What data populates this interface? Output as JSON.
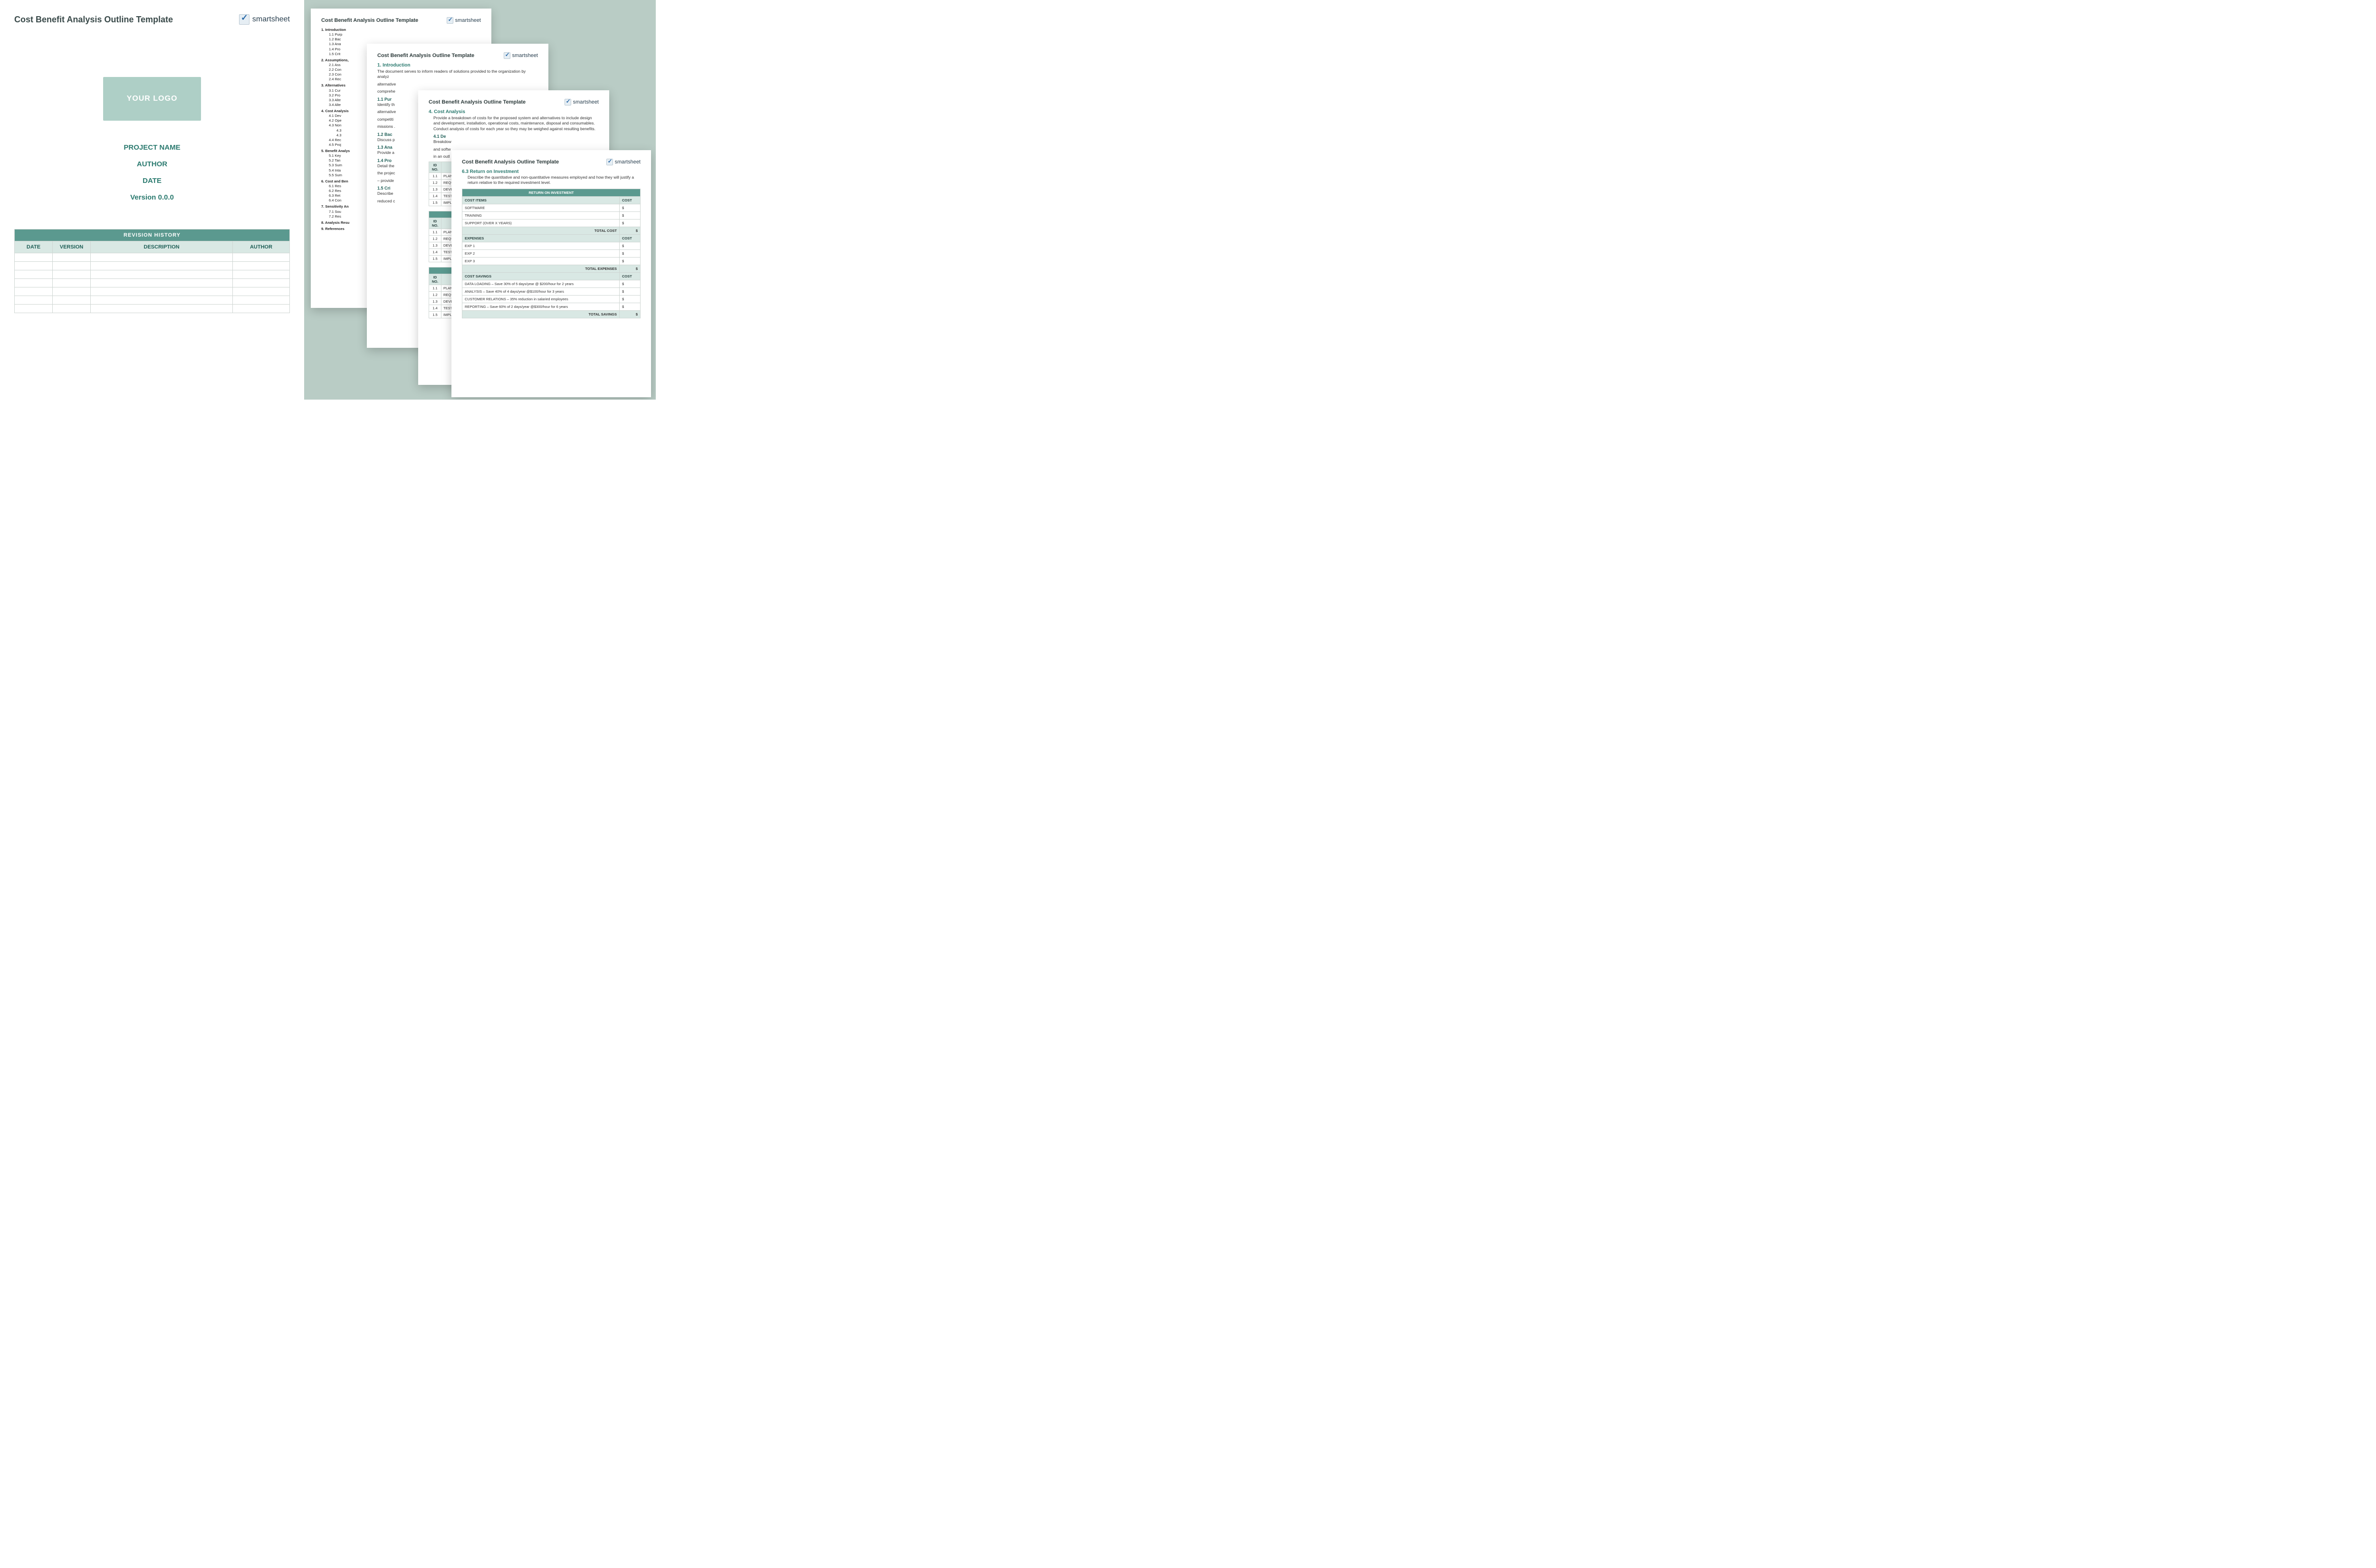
{
  "brand": {
    "name": "smartsheet"
  },
  "title": "Cost Benefit Analysis Outline Template",
  "cover": {
    "logo_label": "YOUR LOGO",
    "project_name": "PROJECT NAME",
    "author": "AUTHOR",
    "date": "DATE",
    "version": "Version 0.0.0"
  },
  "revision_table": {
    "bar": "REVISION HISTORY",
    "cols": [
      "DATE",
      "VERSION",
      "DESCRIPTION",
      "AUTHOR"
    ],
    "blank_rows": 7
  },
  "page2_toc": {
    "items": [
      {
        "l": 1,
        "n": "1.",
        "t": "Introduction"
      },
      {
        "l": 2,
        "n": "1.1",
        "t": "Purp"
      },
      {
        "l": 2,
        "n": "1.2",
        "t": "Bac"
      },
      {
        "l": 2,
        "n": "1.3",
        "t": "Ana"
      },
      {
        "l": 2,
        "n": "1.4",
        "t": "Pro"
      },
      {
        "l": 2,
        "n": "1.5",
        "t": "Crit"
      },
      {
        "l": 1,
        "n": "2.",
        "t": "Assumptions,"
      },
      {
        "l": 2,
        "n": "2.1",
        "t": "Ass"
      },
      {
        "l": 2,
        "n": "2.2",
        "t": "Con"
      },
      {
        "l": 2,
        "n": "2.3",
        "t": "Con"
      },
      {
        "l": 2,
        "n": "2.4",
        "t": "Rec"
      },
      {
        "l": 1,
        "n": "3.",
        "t": "Alternatives"
      },
      {
        "l": 2,
        "n": "3.1",
        "t": "Cur"
      },
      {
        "l": 2,
        "n": "3.2",
        "t": "Pro"
      },
      {
        "l": 2,
        "n": "3.3",
        "t": "Alte"
      },
      {
        "l": 2,
        "n": "3.4",
        "t": "Alte"
      },
      {
        "l": 1,
        "n": "4.",
        "t": "Cost Analysis"
      },
      {
        "l": 2,
        "n": "4.1",
        "t": "Dev"
      },
      {
        "l": 2,
        "n": "4.2",
        "t": "Ope"
      },
      {
        "l": 2,
        "n": "4.3",
        "t": "Non"
      },
      {
        "l": 3,
        "n": "4.3",
        "t": ""
      },
      {
        "l": 3,
        "n": "4.3",
        "t": ""
      },
      {
        "l": 2,
        "n": "4.4",
        "t": "Rec"
      },
      {
        "l": 2,
        "n": "4.5",
        "t": "Proj"
      },
      {
        "l": 1,
        "n": "5.",
        "t": "Benefit Analys"
      },
      {
        "l": 2,
        "n": "5.1",
        "t": "Key"
      },
      {
        "l": 2,
        "n": "5.2",
        "t": "Tan"
      },
      {
        "l": 2,
        "n": "5.3",
        "t": "Sum"
      },
      {
        "l": 2,
        "n": "5.4",
        "t": "Inta"
      },
      {
        "l": 2,
        "n": "5.5",
        "t": "Sum"
      },
      {
        "l": 1,
        "n": "6.",
        "t": "Cost and Ben"
      },
      {
        "l": 2,
        "n": "6.1",
        "t": "Res"
      },
      {
        "l": 2,
        "n": "6.2",
        "t": "Res"
      },
      {
        "l": 2,
        "n": "6.3",
        "t": "Ret"
      },
      {
        "l": 2,
        "n": "6.4",
        "t": "Con"
      },
      {
        "l": 1,
        "n": "7.",
        "t": "Sensitivity An"
      },
      {
        "l": 2,
        "n": "7.1",
        "t": "Sou"
      },
      {
        "l": 2,
        "n": "7.2",
        "t": "Res"
      },
      {
        "l": 1,
        "n": "8.",
        "t": "Analysis Resu"
      },
      {
        "l": 1,
        "n": "9.",
        "t": "References"
      }
    ]
  },
  "page3": {
    "sec1": "1. Introduction",
    "intro": "The document serves to inform readers of solutions provided to the organization by analyz",
    "intro2": "alternative",
    "intro3": "comprehe",
    "h11": "1.1  Pur",
    "t11a": "Identify th",
    "t11b": "alternative",
    "t11c": "competiti",
    "t11d": "missions .",
    "h12": "1.2  Bac",
    "t12": "Discuss p",
    "h13": "1.3  Ana",
    "t13": "Provide a",
    "h14": "1.4  Pro",
    "t14a": "Detail the",
    "t14b": "the projec",
    "t14c": "– provide",
    "h15": "1.5  Cri",
    "t15a": "Describe",
    "t15b": "reduced c"
  },
  "page4": {
    "sec4": "4. Cost Analysis",
    "sec4_body": "Provide a breakdown of costs for the proposed system and alternatives to include design and development, installation, operational costs, maintenance, disposal and consumables. Conduct analysis of costs for each year so they may be weighed against resulting benefits.",
    "h41": "4.1  De",
    "t41a": "Breakdow",
    "t41b": "and softw",
    "t41c": "in an outl",
    "mini_header": {
      "c1": "ID NO.",
      "c2": ""
    },
    "mini_rows": [
      {
        "n": "1.1",
        "t": "PLANN"
      },
      {
        "n": "1.2",
        "t": "REQUI"
      },
      {
        "n": "1.3",
        "t": "DEVEL"
      },
      {
        "n": "1.4",
        "t": "TESTI"
      },
      {
        "n": "1.5",
        "t": "IMPLE"
      }
    ]
  },
  "page5": {
    "h63": "6.3  Return on Investment",
    "t63": "Describe the quantitative and non-quantitative measures employed and how they will justify a return relative to the required investment level.",
    "roi": {
      "bar": "RETURN ON INVESTMENT",
      "sub_items": "COST ITEMS",
      "sub_cost": "COST",
      "items": [
        "SOFTWARE",
        "TRAINING",
        "SUPPORT (OVER X YEARS)"
      ],
      "total_cost": "TOTAL COST",
      "sub_exp": "EXPENSES",
      "exps": [
        "EXP 1",
        "EXP 2",
        "EXP 3"
      ],
      "total_exp": "TOTAL EXPENSES",
      "sub_sav": "COST SAVINGS",
      "savs": [
        "DATA LOADING – Save 30% of 5 days/year @ $200/hour for 2 years",
        "ANALYSIS – Save 40% of 4 days/year @$100/hour for 3 years",
        "CUSTOMER RELATIONS – 35% reduction in salaried employees",
        "REPORTING – Save 60% of 2 days/year @$300/hour for 6 years"
      ],
      "total_sav": "TOTAL SAVINGS",
      "dollar": "$"
    }
  }
}
